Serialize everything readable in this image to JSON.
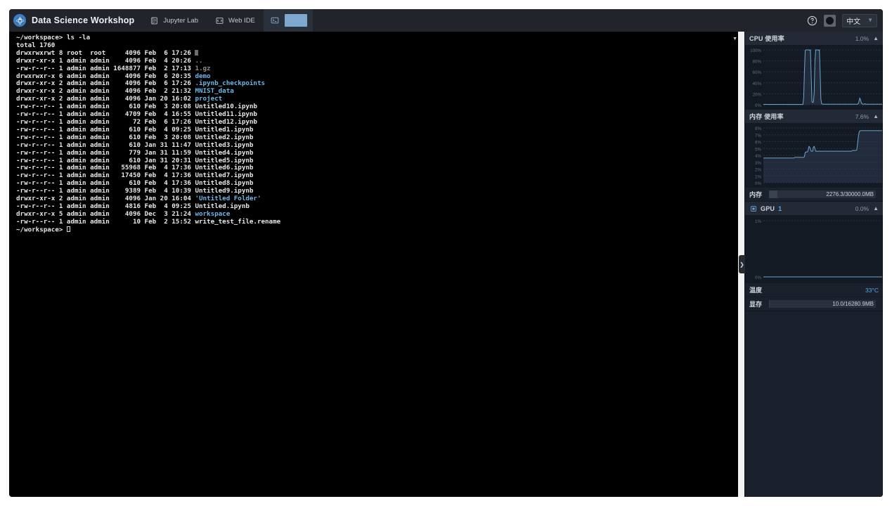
{
  "header": {
    "brand_title": "Data Science Workshop",
    "brand_logo_icon": "workshop-logo-icon",
    "tabs": [
      {
        "label": "Jupyter Lab",
        "icon": "notebook-icon",
        "active": false
      },
      {
        "label": "Web IDE",
        "icon": "code-editor-icon",
        "active": false
      },
      {
        "label": "",
        "icon": "terminal-icon",
        "active": true
      }
    ],
    "help_icon": "help-circle-icon",
    "avatar_icon": "user-avatar",
    "language": {
      "selected": "中文",
      "chevron_icon": "chevron-down-icon"
    }
  },
  "terminal": {
    "prompt": "~/workspace>",
    "command": "ls -la",
    "lines": [
      {
        "text": "~/workspace> ls -la",
        "type": "prompt"
      },
      {
        "text": "total 1760",
        "type": "plain"
      },
      {
        "perms": "drwxrwxrwt",
        "links": "8",
        "owner": "root",
        "group": "root",
        "size": "4096",
        "month": "Feb",
        "day": "6",
        "time": "17:26",
        "name": ".",
        "kind": "cursor"
      },
      {
        "perms": "drwxr-xr-x",
        "links": "1",
        "owner": "admin",
        "group": "admin",
        "size": "4096",
        "month": "Feb",
        "day": "4",
        "time": "20:26",
        "name": "..",
        "kind": "dim"
      },
      {
        "perms": "-rw-r--r--",
        "links": "1",
        "owner": "admin",
        "group": "admin",
        "size": "1648877",
        "month": "Feb",
        "day": "2",
        "time": "17:13",
        "name": "1.gz",
        "kind": "dim"
      },
      {
        "perms": "drwxrwxr-x",
        "links": "6",
        "owner": "admin",
        "group": "admin",
        "size": "4096",
        "month": "Feb",
        "day": "6",
        "time": "20:35",
        "name": "demo",
        "kind": "dir"
      },
      {
        "perms": "drwxr-xr-x",
        "links": "2",
        "owner": "admin",
        "group": "admin",
        "size": "4096",
        "month": "Feb",
        "day": "6",
        "time": "17:26",
        "name": ".ipynb_checkpoints",
        "kind": "dir"
      },
      {
        "perms": "drwxr-xr-x",
        "links": "2",
        "owner": "admin",
        "group": "admin",
        "size": "4096",
        "month": "Feb",
        "day": "2",
        "time": "21:32",
        "name": "MNIST_data",
        "kind": "dir"
      },
      {
        "perms": "drwxr-xr-x",
        "links": "2",
        "owner": "admin",
        "group": "admin",
        "size": "4096",
        "month": "Jan",
        "day": "20",
        "time": "16:02",
        "name": "project",
        "kind": "dir"
      },
      {
        "perms": "-rw-r--r--",
        "links": "1",
        "owner": "admin",
        "group": "admin",
        "size": "610",
        "month": "Feb",
        "day": "3",
        "time": "20:08",
        "name": "Untitled10.ipynb",
        "kind": "file"
      },
      {
        "perms": "-rw-r--r--",
        "links": "1",
        "owner": "admin",
        "group": "admin",
        "size": "4709",
        "month": "Feb",
        "day": "4",
        "time": "16:55",
        "name": "Untitled11.ipynb",
        "kind": "file"
      },
      {
        "perms": "-rw-r--r--",
        "links": "1",
        "owner": "admin",
        "group": "admin",
        "size": "72",
        "month": "Feb",
        "day": "6",
        "time": "17:26",
        "name": "Untitled12.ipynb",
        "kind": "file"
      },
      {
        "perms": "-rw-r--r--",
        "links": "1",
        "owner": "admin",
        "group": "admin",
        "size": "610",
        "month": "Feb",
        "day": "4",
        "time": "09:25",
        "name": "Untitled1.ipynb",
        "kind": "file"
      },
      {
        "perms": "-rw-r--r--",
        "links": "1",
        "owner": "admin",
        "group": "admin",
        "size": "610",
        "month": "Feb",
        "day": "3",
        "time": "20:08",
        "name": "Untitled2.ipynb",
        "kind": "file"
      },
      {
        "perms": "-rw-r--r--",
        "links": "1",
        "owner": "admin",
        "group": "admin",
        "size": "610",
        "month": "Jan",
        "day": "31",
        "time": "11:47",
        "name": "Untitled3.ipynb",
        "kind": "file"
      },
      {
        "perms": "-rw-r--r--",
        "links": "1",
        "owner": "admin",
        "group": "admin",
        "size": "779",
        "month": "Jan",
        "day": "31",
        "time": "11:59",
        "name": "Untitled4.ipynb",
        "kind": "file"
      },
      {
        "perms": "-rw-r--r--",
        "links": "1",
        "owner": "admin",
        "group": "admin",
        "size": "610",
        "month": "Jan",
        "day": "31",
        "time": "20:31",
        "name": "Untitled5.ipynb",
        "kind": "file"
      },
      {
        "perms": "-rw-r--r--",
        "links": "1",
        "owner": "admin",
        "group": "admin",
        "size": "55968",
        "month": "Feb",
        "day": "4",
        "time": "17:36",
        "name": "Untitled6.ipynb",
        "kind": "file"
      },
      {
        "perms": "-rw-r--r--",
        "links": "1",
        "owner": "admin",
        "group": "admin",
        "size": "17450",
        "month": "Feb",
        "day": "4",
        "time": "17:36",
        "name": "Untitled7.ipynb",
        "kind": "file"
      },
      {
        "perms": "-rw-r--r--",
        "links": "1",
        "owner": "admin",
        "group": "admin",
        "size": "610",
        "month": "Feb",
        "day": "4",
        "time": "17:36",
        "name": "Untitled8.ipynb",
        "kind": "file"
      },
      {
        "perms": "-rw-r--r--",
        "links": "1",
        "owner": "admin",
        "group": "admin",
        "size": "9389",
        "month": "Feb",
        "day": "4",
        "time": "10:39",
        "name": "Untitled9.ipynb",
        "kind": "file"
      },
      {
        "perms": "drwxr-xr-x",
        "links": "2",
        "owner": "admin",
        "group": "admin",
        "size": "4096",
        "month": "Jan",
        "day": "20",
        "time": "16:04",
        "name": "'Untitled Folder'",
        "kind": "quote"
      },
      {
        "perms": "-rw-r--r--",
        "links": "1",
        "owner": "admin",
        "group": "admin",
        "size": "4816",
        "month": "Feb",
        "day": "4",
        "time": "09:25",
        "name": "Untitled.ipynb",
        "kind": "file"
      },
      {
        "perms": "drwxr-xr-x",
        "links": "5",
        "owner": "admin",
        "group": "admin",
        "size": "4096",
        "month": "Dec",
        "day": "3",
        "time": "21:24",
        "name": "workspace",
        "kind": "dir"
      },
      {
        "perms": "-rw-r--r--",
        "links": "1",
        "owner": "admin",
        "group": "admin",
        "size": "10",
        "month": "Feb",
        "day": "2",
        "time": "15:52",
        "name": "write_test_file.rename",
        "kind": "file"
      }
    ],
    "final_prompt": "~/workspace>"
  },
  "divider": {
    "collapse_icon": "chevron-right-icon"
  },
  "sidebar": {
    "panels": [
      {
        "id": "cpu",
        "title": "CPU 使用率",
        "badge": "",
        "value": "1.0%",
        "caret_icon": "chevron-up-icon",
        "icon": ""
      },
      {
        "id": "memory",
        "title": "内存 使用率",
        "badge": "",
        "value": "7.6%",
        "caret_icon": "chevron-up-icon",
        "icon": ""
      },
      {
        "id": "gpu",
        "title": "GPU",
        "badge": "1",
        "value": "0.0%",
        "caret_icon": "chevron-up-icon",
        "icon": "gpu-chip-icon"
      }
    ],
    "stats": [
      {
        "id": "memory-stat",
        "label": "内存",
        "bar_text": "2276.3/30000.0MB",
        "fill_pct": 7.6
      },
      {
        "id": "gpu-temp",
        "label": "温度",
        "value": "33°C"
      },
      {
        "id": "gpu-vram",
        "label": "显存",
        "bar_text": "10.0/16280.9MB",
        "fill_pct": 0.1
      }
    ]
  },
  "chart_data": [
    {
      "id": "cpu-usage-chart",
      "type": "line",
      "title": "CPU 使用率",
      "ylabel": "",
      "xlabel": "",
      "ylim": [
        0,
        100
      ],
      "yticks": [
        0,
        20,
        40,
        60,
        80,
        100
      ],
      "ytick_labels": [
        "0%",
        "20%",
        "40%",
        "60%",
        "80%",
        "100%"
      ],
      "grid": true,
      "current_value": 1.0,
      "unit": "%",
      "values": [
        0.5,
        0.6,
        0.5,
        0.8,
        0.6,
        0.5,
        0.7,
        0.6,
        0.5,
        0.6,
        0.5,
        0.7,
        0.6,
        0.5,
        0.6,
        0.5,
        0.6,
        0.7,
        0.5,
        0.6,
        0.5,
        0.6,
        0.5,
        0.7,
        0.6,
        0.5,
        0.6,
        0.5,
        0.6,
        0.5,
        0.6,
        0.7,
        0.5,
        0.6,
        0.5,
        0.6,
        0.5,
        0.6,
        0.5,
        0.6,
        0.5,
        0.6,
        0.5,
        0.6,
        0.5,
        0.6,
        0.5,
        0.6,
        0.5,
        0.6,
        0.5,
        0.6,
        0.5,
        0.6,
        14,
        62,
        99,
        100,
        100,
        100,
        100,
        100,
        99,
        100,
        52,
        6,
        4,
        5,
        22,
        78,
        100,
        100,
        100,
        100,
        99,
        100,
        58,
        10,
        2,
        1,
        1,
        1,
        1,
        1,
        1,
        1,
        1,
        1,
        1,
        1,
        1,
        1,
        1,
        1,
        1,
        1,
        1,
        1,
        1,
        1,
        1,
        1,
        1,
        1,
        1,
        1,
        1,
        1,
        1,
        1,
        1,
        1,
        1,
        1,
        1,
        1,
        1,
        1,
        1,
        1,
        1,
        1,
        1,
        1,
        1,
        1,
        1,
        2,
        6,
        12,
        9,
        4,
        2,
        1,
        1,
        1,
        2,
        1,
        1,
        1,
        1,
        1,
        1,
        1,
        1,
        1,
        1,
        1,
        1,
        1,
        1,
        1,
        1,
        1,
        1,
        1,
        1,
        1,
        1,
        1
      ]
    },
    {
      "id": "memory-usage-chart",
      "type": "line",
      "title": "内存 使用率",
      "ylabel": "",
      "xlabel": "",
      "ylim": [
        0,
        8
      ],
      "yticks": [
        0,
        1,
        2,
        3,
        4,
        5,
        6,
        7,
        8
      ],
      "ytick_labels": [
        "0%",
        "1%",
        "2%",
        "3%",
        "4%",
        "5%",
        "6%",
        "7%",
        "8%"
      ],
      "grid": true,
      "current_value": 7.6,
      "unit": "%",
      "values": [
        3.6,
        3.6,
        3.6,
        3.6,
        3.6,
        3.6,
        3.6,
        3.6,
        3.6,
        3.6,
        3.6,
        3.6,
        3.6,
        3.6,
        3.6,
        3.6,
        3.6,
        3.6,
        3.6,
        3.6,
        3.6,
        3.6,
        3.6,
        3.6,
        3.6,
        3.6,
        3.6,
        3.6,
        3.6,
        3.6,
        3.6,
        3.6,
        3.6,
        3.6,
        3.6,
        3.6,
        3.6,
        3.6,
        3.6,
        3.6,
        3.6,
        3.6,
        3.7,
        3.7,
        3.7,
        3.7,
        3.7,
        3.7,
        3.7,
        3.7,
        3.7,
        3.7,
        3.7,
        3.7,
        3.7,
        3.8,
        4.4,
        4.5,
        4.5,
        4.5,
        4.8,
        5.3,
        5.2,
        4.9,
        4.6,
        4.6,
        4.6,
        5.2,
        5.3,
        5.0,
        4.6,
        4.6,
        4.6,
        4.6,
        4.6,
        4.6,
        4.6,
        4.6,
        4.6,
        4.6,
        4.6,
        4.6,
        4.6,
        4.6,
        4.6,
        4.6,
        4.6,
        4.6,
        4.6,
        4.6,
        4.6,
        4.6,
        4.6,
        4.6,
        4.6,
        4.6,
        4.6,
        4.6,
        4.6,
        4.6,
        4.6,
        4.6,
        4.6,
        4.6,
        4.6,
        4.6,
        4.6,
        4.6,
        4.6,
        4.6,
        4.6,
        4.6,
        4.6,
        4.6,
        4.6,
        4.6,
        4.6,
        4.6,
        4.6,
        4.7,
        4.7,
        4.7,
        4.7,
        4.7,
        4.7,
        4.8,
        5.6,
        6.6,
        7.3,
        7.55,
        7.6,
        7.6,
        7.6,
        7.6,
        7.6,
        7.6,
        7.6,
        7.6,
        7.6,
        7.6,
        7.6,
        7.6,
        7.6,
        7.6,
        7.6,
        7.6,
        7.6,
        7.6,
        7.6,
        7.6,
        7.6,
        7.6,
        7.6,
        7.6,
        7.6,
        7.6,
        7.6,
        7.6,
        7.6,
        7.6
      ]
    },
    {
      "id": "gpu-usage-chart",
      "type": "line",
      "title": "GPU 1",
      "ylabel": "",
      "xlabel": "",
      "ylim": [
        0,
        1
      ],
      "yticks": [
        0,
        1
      ],
      "ytick_labels": [
        "0%",
        "1%"
      ],
      "grid": true,
      "current_value": 0.0,
      "unit": "%",
      "values": [
        0,
        0,
        0,
        0,
        0,
        0,
        0,
        0,
        0,
        0,
        0,
        0,
        0,
        0,
        0,
        0,
        0,
        0,
        0,
        0,
        0,
        0,
        0,
        0,
        0,
        0,
        0,
        0,
        0,
        0,
        0,
        0,
        0,
        0,
        0,
        0,
        0,
        0,
        0,
        0,
        0,
        0,
        0,
        0,
        0,
        0,
        0,
        0,
        0,
        0,
        0,
        0,
        0,
        0,
        0,
        0,
        0,
        0,
        0,
        0,
        0,
        0,
        0,
        0,
        0,
        0,
        0,
        0,
        0,
        0,
        0,
        0,
        0,
        0,
        0,
        0,
        0,
        0,
        0,
        0,
        0,
        0,
        0,
        0,
        0,
        0,
        0,
        0,
        0,
        0,
        0,
        0,
        0,
        0,
        0,
        0,
        0,
        0,
        0,
        0,
        0,
        0,
        0,
        0,
        0,
        0,
        0,
        0,
        0,
        0,
        0,
        0,
        0,
        0,
        0,
        0,
        0,
        0,
        0,
        0,
        0,
        0,
        0,
        0,
        0,
        0,
        0,
        0,
        0,
        0,
        0,
        0,
        0,
        0,
        0,
        0,
        0,
        0,
        0,
        0,
        0,
        0,
        0,
        0,
        0,
        0,
        0,
        0,
        0,
        0,
        0,
        0,
        0,
        0,
        0,
        0,
        0,
        0,
        0,
        0
      ]
    }
  ]
}
